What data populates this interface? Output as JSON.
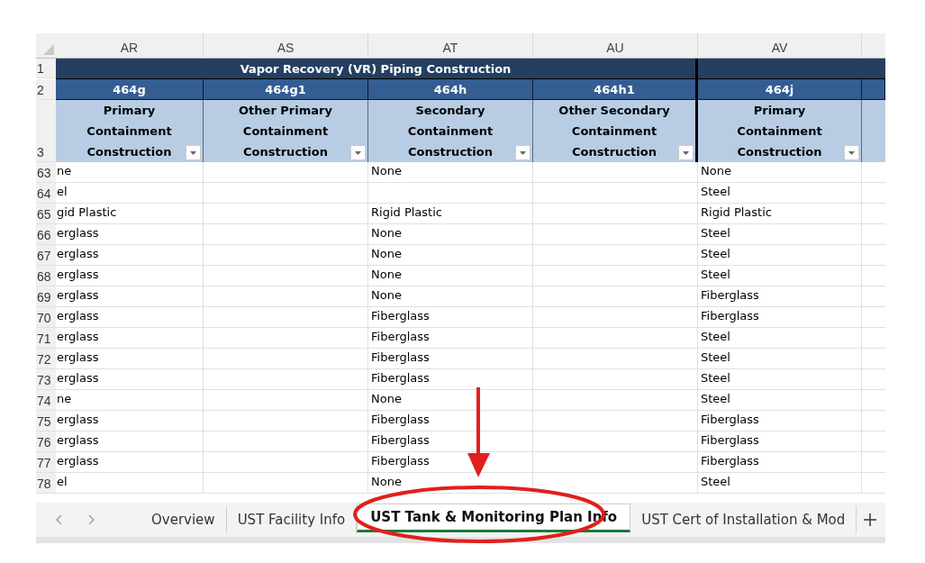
{
  "sheet": {
    "columns": [
      {
        "letter": "AR"
      },
      {
        "letter": "AS"
      },
      {
        "letter": "AT"
      },
      {
        "letter": "AU"
      },
      {
        "letter": "AV"
      }
    ],
    "header_rows": [
      {
        "number": "1"
      },
      {
        "number": "2"
      },
      {
        "number": "3"
      }
    ],
    "group_title": "Vapor Recovery (VR) Piping Construction",
    "codes": [
      "464g",
      "464g1",
      "464h",
      "464h1",
      "464j"
    ],
    "labels": [
      "Primary Containment Construction",
      "Other Primary Containment Construction",
      "Secondary Containment Construction",
      "Other Secondary Containment Construction",
      "Primary Containment Construction"
    ],
    "rows": [
      {
        "number": "63",
        "ar": "ne",
        "at": "None",
        "av": "None"
      },
      {
        "number": "64",
        "ar": "el",
        "av": "Steel"
      },
      {
        "number": "65",
        "ar": "gid Plastic",
        "at": "Rigid Plastic",
        "av": "Rigid Plastic"
      },
      {
        "number": "66",
        "ar": "erglass",
        "at": "None",
        "av": "Steel"
      },
      {
        "number": "67",
        "ar": "erglass",
        "at": "None",
        "av": "Steel"
      },
      {
        "number": "68",
        "ar": "erglass",
        "at": "None",
        "av": "Steel"
      },
      {
        "number": "69",
        "ar": "erglass",
        "at": "None",
        "av": "Fiberglass"
      },
      {
        "number": "70",
        "ar": "erglass",
        "at": "Fiberglass",
        "av": "Fiberglass"
      },
      {
        "number": "71",
        "ar": "erglass",
        "at": "Fiberglass",
        "av": "Steel"
      },
      {
        "number": "72",
        "ar": "erglass",
        "at": "Fiberglass",
        "av": "Steel"
      },
      {
        "number": "73",
        "ar": "erglass",
        "at": "Fiberglass",
        "av": "Steel"
      },
      {
        "number": "74",
        "ar": "ne",
        "at": "None",
        "av": "Steel"
      },
      {
        "number": "75",
        "ar": "erglass",
        "at": "Fiberglass",
        "av": "Fiberglass"
      },
      {
        "number": "76",
        "ar": "erglass",
        "at": "Fiberglass",
        "av": "Fiberglass"
      },
      {
        "number": "77",
        "ar": "erglass",
        "at": "Fiberglass",
        "av": "Fiberglass"
      },
      {
        "number": "78",
        "ar": "el",
        "at": "None",
        "av": "Steel"
      }
    ]
  },
  "sheet_tabs": [
    {
      "label": "Overview",
      "selected": false
    },
    {
      "label": "UST Facility Info",
      "selected": false
    },
    {
      "label": "UST Tank & Monitoring Plan Info",
      "selected": true
    },
    {
      "label": "UST Cert of Installation & Mod",
      "selected": false
    }
  ],
  "annotation": {
    "arrow": true,
    "circle": true
  }
}
